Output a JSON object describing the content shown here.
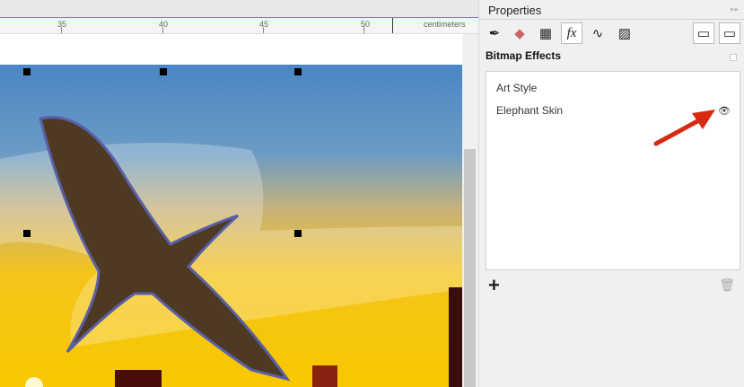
{
  "ruler": {
    "labels": [
      "35",
      "40",
      "45",
      "50"
    ],
    "unit": "centimeters"
  },
  "panel": {
    "title": "Properties",
    "collapse_icon": "double-chevron-right",
    "tabs": [
      {
        "name": "outline",
        "glyph": "✒"
      },
      {
        "name": "fill",
        "glyph": "◆"
      },
      {
        "name": "transparency",
        "glyph": "▦"
      },
      {
        "name": "effects",
        "glyph": "fx"
      },
      {
        "name": "curve",
        "glyph": "∿"
      },
      {
        "name": "bitmap",
        "glyph": "▨"
      }
    ],
    "section_title": "Bitmap Effects",
    "effects": [
      "Art Style",
      "Elephant Skin"
    ],
    "add_glyph": "+",
    "delete_glyph": "🗑"
  },
  "colors": {
    "sky_top": "#4a86c5",
    "sky_bottom": "#f7c400",
    "arrow": "#d62a12"
  }
}
